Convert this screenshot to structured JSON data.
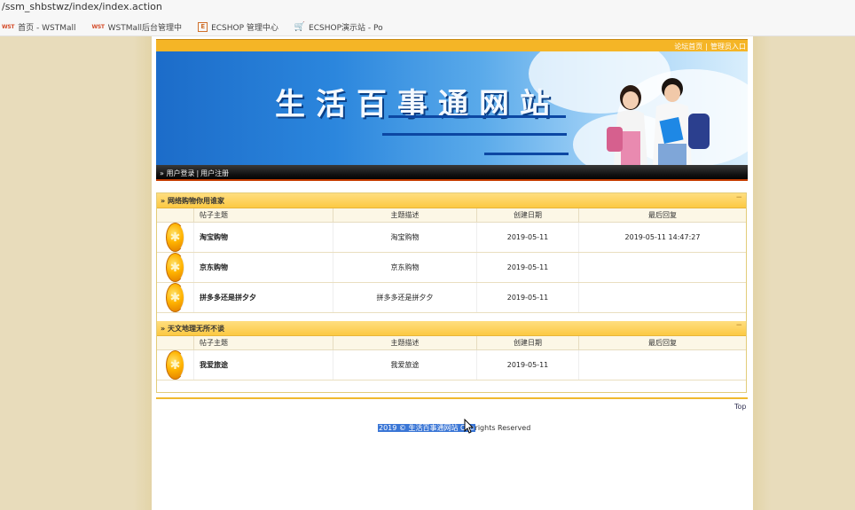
{
  "browser": {
    "url": "/ssm_shbstwz/index/index.action",
    "bookmarks": [
      {
        "icon": "wst-logo-icon",
        "icon_text": "WST",
        "label": "首页 - WSTMall"
      },
      {
        "icon": "wst-logo-icon",
        "icon_text": "WST",
        "label": "WSTMall后台管理中"
      },
      {
        "icon": "ecshop-icon",
        "icon_text": "E",
        "label": "ECSHOP 管理中心"
      },
      {
        "icon": "cart-icon",
        "icon_text": "🛒",
        "label": "ECSHOP演示站 - Po"
      }
    ]
  },
  "header": {
    "top_links": [
      "论坛首页",
      "管理员入口"
    ],
    "banner_title": "生活百事通网站",
    "nav_links": [
      "用户登录",
      "用户注册"
    ]
  },
  "columns": [
    "帖子主题",
    "主题描述",
    "创建日期",
    "最后回复"
  ],
  "sections": [
    {
      "title": "网络购物你用谁家",
      "collapse": "−",
      "rows": [
        {
          "title": "淘宝购物",
          "desc": "淘宝购物",
          "date": "2019-05-11",
          "last": "2019-05-11 14:47:27"
        },
        {
          "title": "京东购物",
          "desc": "京东购物",
          "date": "2019-05-11",
          "last": ""
        },
        {
          "title": "拼多多还是拼夕夕",
          "desc": "拼多多还是拼夕夕",
          "date": "2019-05-11",
          "last": ""
        }
      ]
    },
    {
      "title": "天文地理无所不谈",
      "collapse": "−",
      "rows": [
        {
          "title": "我爱旅途",
          "desc": "我爱旅途",
          "date": "2019-05-11",
          "last": ""
        }
      ]
    }
  ],
  "footer": {
    "top_link": "Top",
    "copyright_selected": "2019 © 生活百事通网站 Cop",
    "copyright_rest": "rights Reserved"
  },
  "colors": {
    "accent": "#f5b526",
    "header_bar": "#fcc943",
    "banner": "#2b86dd"
  }
}
